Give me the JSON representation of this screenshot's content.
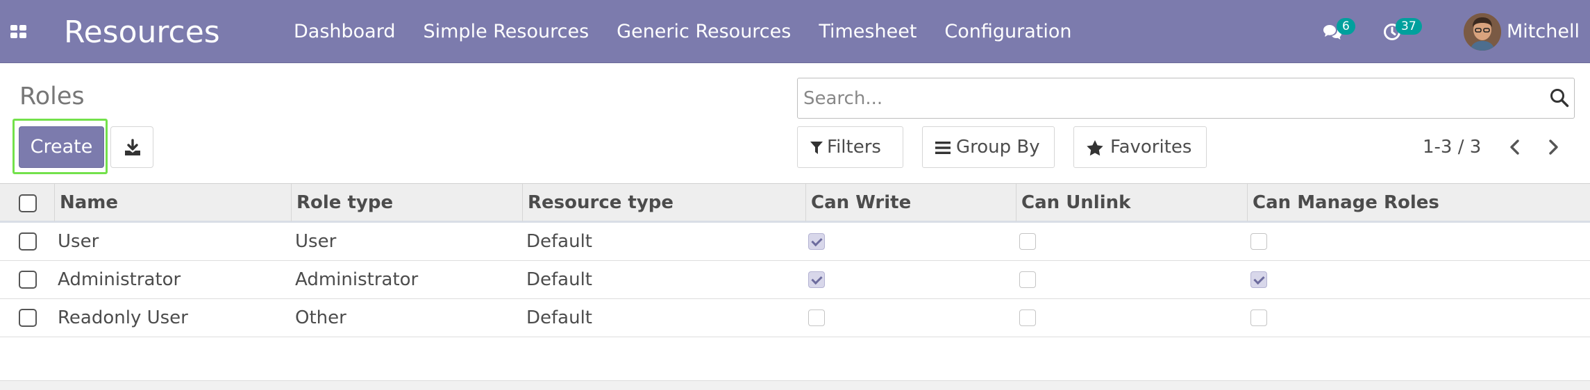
{
  "navbar": {
    "app_name": "Resources",
    "menu": [
      "Dashboard",
      "Simple Resources",
      "Generic Resources",
      "Timesheet",
      "Configuration"
    ],
    "messages_count": "6",
    "activities_count": "37",
    "user_name": "Mitchell",
    "colors": {
      "bar": "#7c7bad",
      "badge": "#00a09d"
    }
  },
  "control_panel": {
    "title": "Roles",
    "create_label": "Create",
    "search_placeholder": "Search...",
    "filters_label": "Filters",
    "group_by_label": "Group By",
    "favorites_label": "Favorites",
    "pager": "1-3 / 3"
  },
  "table": {
    "headers": [
      "Name",
      "Role type",
      "Resource type",
      "Can Write",
      "Can Unlink",
      "Can Manage Roles"
    ],
    "rows": [
      {
        "name": "User",
        "role_type": "User",
        "resource_type": "Default",
        "can_write": true,
        "can_unlink": false,
        "can_manage_roles": false
      },
      {
        "name": "Administrator",
        "role_type": "Administrator",
        "resource_type": "Default",
        "can_write": true,
        "can_unlink": false,
        "can_manage_roles": true
      },
      {
        "name": "Readonly User",
        "role_type": "Other",
        "resource_type": "Default",
        "can_write": false,
        "can_unlink": false,
        "can_manage_roles": false
      }
    ]
  }
}
